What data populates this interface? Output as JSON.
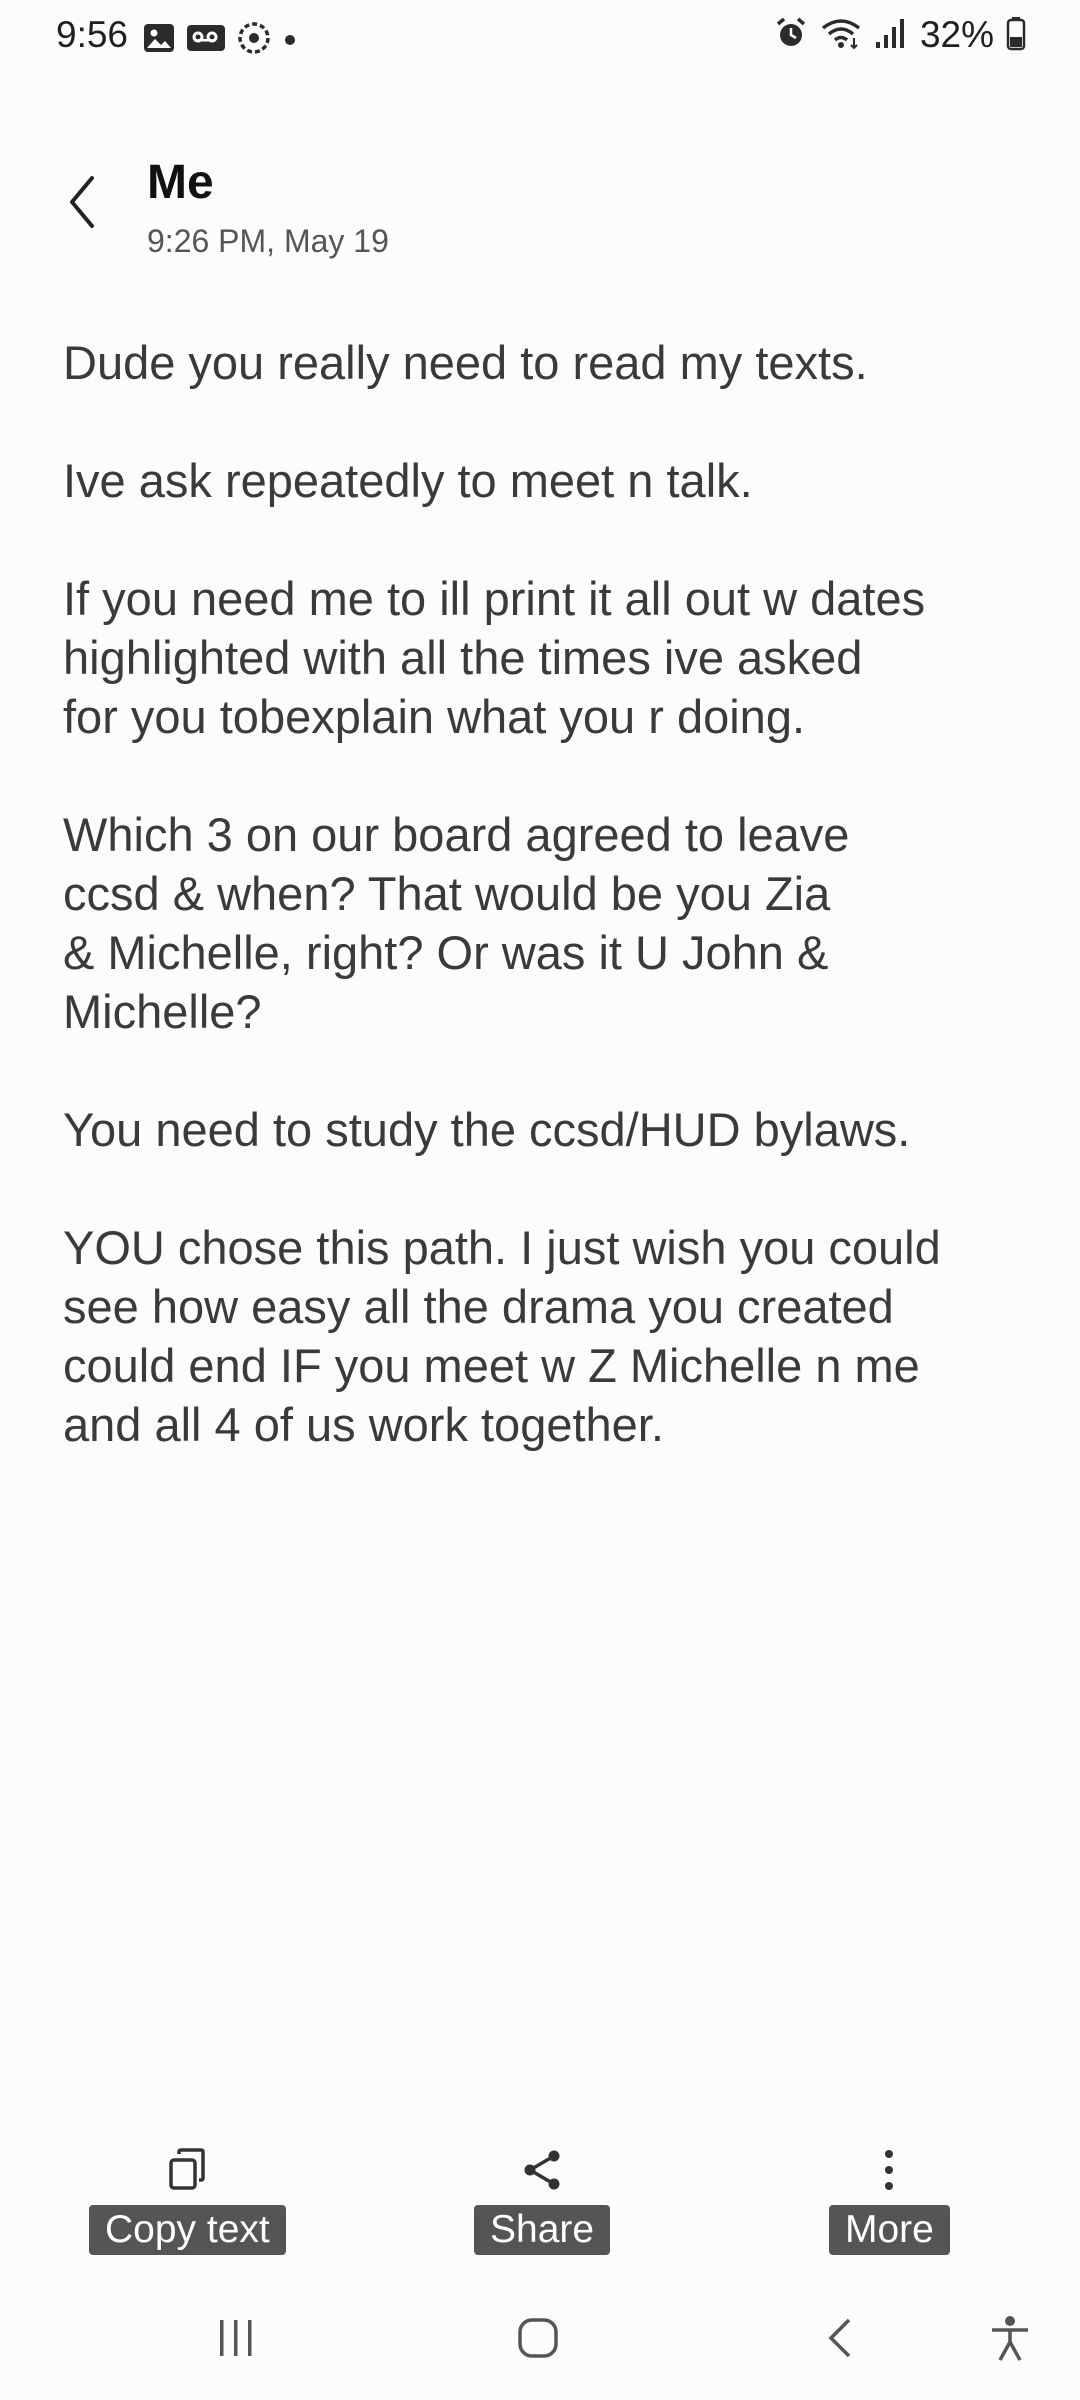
{
  "status_bar": {
    "time": "9:56",
    "battery": "32%",
    "left_icons": [
      "gallery-icon",
      "voicemail-icon",
      "sync-icon",
      "dot-icon"
    ],
    "right_icons": [
      "alarm-icon",
      "wifi-icon",
      "signal-icon",
      "battery-icon"
    ]
  },
  "header": {
    "back_icon": "chevron-left-icon",
    "title": "Me",
    "subtitle": "9:26 PM, May 19"
  },
  "message": {
    "paragraphs": [
      "Dude you really need to read my texts.",
      "Ive ask repeatedly to meet n talk.",
      "If you need me to ill print it all out w dates\nhighlighted with all the times ive asked\nfor you tobexplain what you r doing.",
      "Which 3 on our board agreed to leave\nccsd & when? That would be you Zia\n& Michelle, right? Or was it U John &\nMichelle?",
      "You need to study the ccsd/HUD bylaws.",
      "YOU chose this path. I just wish you could\nsee how easy all the drama you created\ncould end IF you meet w Z Michelle n me\nand all 4 of us work together."
    ]
  },
  "actions": {
    "copy_label": "Copy text",
    "share_label": "Share",
    "more_label": "More"
  },
  "nav_bar": {
    "items": [
      "recents-icon",
      "home-icon",
      "back-icon",
      "accessibility-icon"
    ]
  }
}
